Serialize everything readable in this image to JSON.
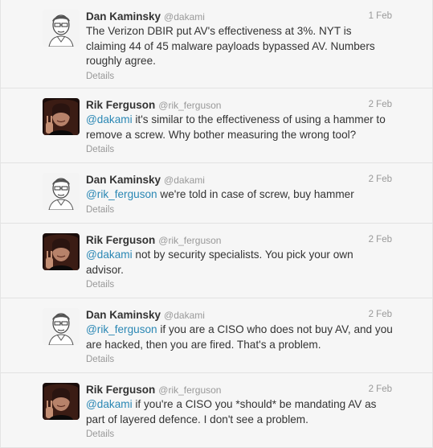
{
  "tweets": [
    {
      "author": "dan",
      "name": "Dan Kaminsky",
      "handle": "@dakami",
      "date": "1 Feb",
      "mention": "",
      "text": "The Verizon DBIR put AV's effectiveness at 3%. NYT is claiming 44 of 45 malware payloads bypassed AV. Numbers roughly agree.",
      "details": "Details"
    },
    {
      "author": "rik",
      "name": "Rik Ferguson",
      "handle": "@rik_ferguson",
      "date": "2 Feb",
      "mention": "@dakami",
      "text": " it's similar to the effectiveness of using a hammer to remove a screw. Why bother measuring the wrong tool?",
      "details": "Details"
    },
    {
      "author": "dan",
      "name": "Dan Kaminsky",
      "handle": "@dakami",
      "date": "2 Feb",
      "mention": "@rik_ferguson",
      "text": " we're told in case of screw, buy hammer",
      "details": "Details"
    },
    {
      "author": "rik",
      "name": "Rik Ferguson",
      "handle": "@rik_ferguson",
      "date": "2 Feb",
      "mention": "@dakami",
      "text": " not by security specialists. You pick your own advisor.",
      "details": "Details"
    },
    {
      "author": "dan",
      "name": "Dan Kaminsky",
      "handle": "@dakami",
      "date": "2 Feb",
      "mention": "@rik_ferguson",
      "text": " if you are a CISO who does not buy AV, and you are hacked, then you are fired. That's a problem.",
      "details": "Details"
    },
    {
      "author": "rik",
      "name": "Rik Ferguson",
      "handle": "@rik_ferguson",
      "date": "2 Feb",
      "mention": "@dakami",
      "text": " if you're a CISO you *should* be mandating AV as part of layered defence. I don't see a problem.",
      "details": "Details"
    }
  ]
}
